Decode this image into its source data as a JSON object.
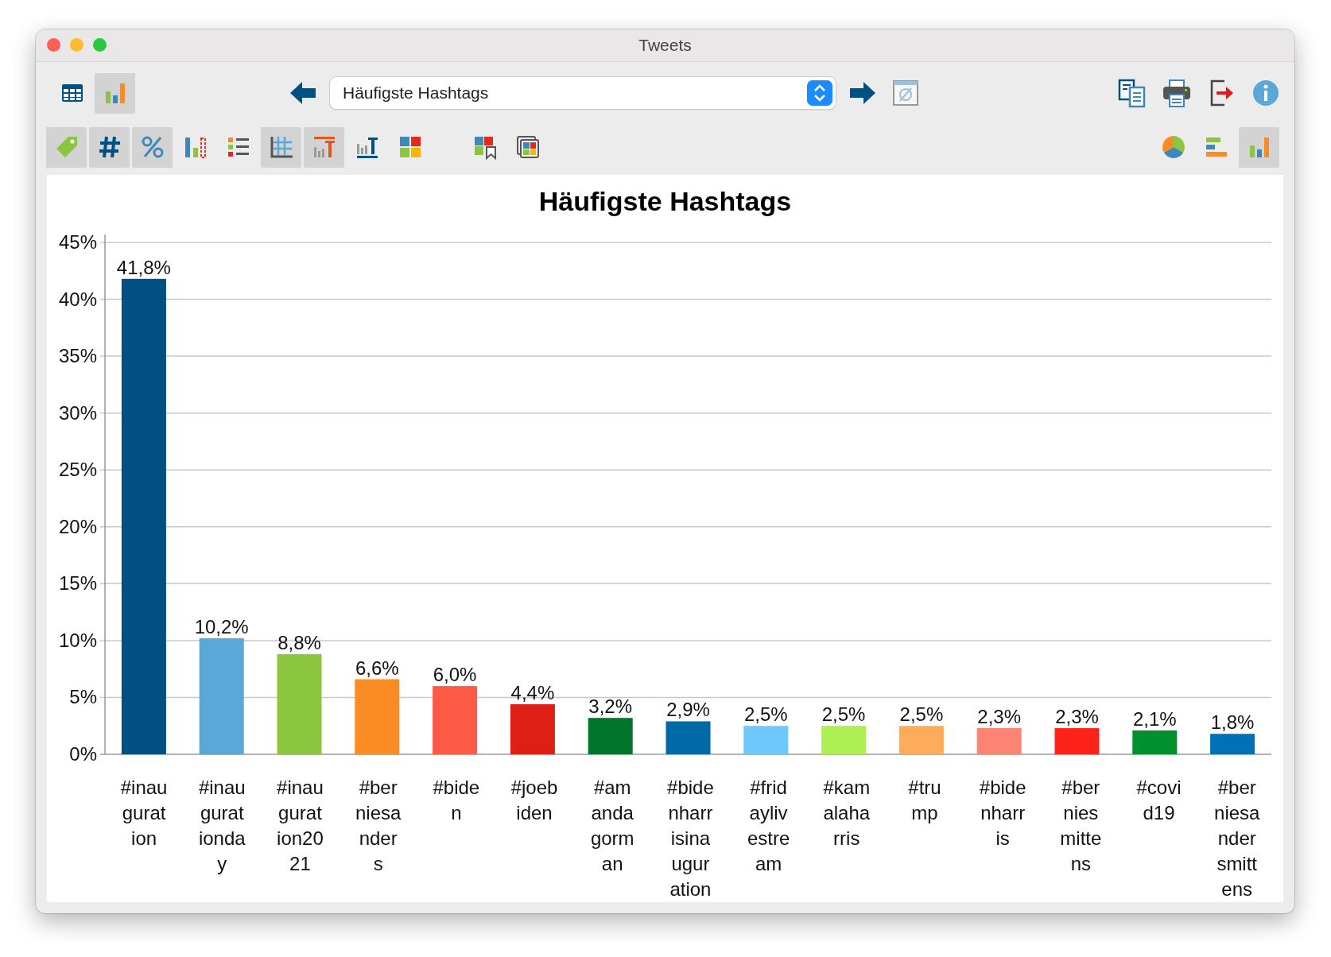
{
  "window": {
    "title": "Tweets"
  },
  "toolbar": {
    "view_buttons": [
      {
        "selected": false
      },
      {
        "selected": true
      }
    ],
    "selector": {
      "value": "Häufigste Hashtags"
    },
    "format_buttons": [
      {
        "selected": true
      },
      {
        "selected": true
      },
      {
        "selected": true
      },
      {
        "selected": false
      },
      {
        "selected": false
      },
      {
        "selected": true
      },
      {
        "selected": true
      },
      {
        "selected": false
      },
      {
        "selected": false
      },
      {
        "selected": false
      },
      {
        "selected": false
      }
    ],
    "chart_type_buttons": [
      {
        "selected": false
      },
      {
        "selected": false
      },
      {
        "selected": true
      }
    ]
  },
  "chart": {
    "chart_data": {
      "type": "bar",
      "title": "Häufigste Hashtags",
      "series": [
        {
          "name": "#inauguration",
          "color": "#005083",
          "values": [
            41.8,
            null,
            null,
            null,
            null,
            null,
            null,
            null,
            null,
            null,
            null,
            null,
            null,
            null,
            null
          ]
        },
        {
          "name": "#inaugurationday",
          "color": "#5aa8d8",
          "values": [
            null,
            10.2,
            null,
            null,
            null,
            null,
            null,
            null,
            null,
            null,
            null,
            null,
            null,
            null,
            null
          ]
        },
        {
          "name": "#inauguration2021",
          "color": "#8cc63f",
          "values": [
            null,
            null,
            8.8,
            null,
            null,
            null,
            null,
            null,
            null,
            null,
            null,
            null,
            null,
            null,
            null
          ]
        },
        {
          "name": "#berniesanders",
          "color": "#fb8c23",
          "values": [
            null,
            null,
            null,
            6.6,
            null,
            null,
            null,
            null,
            null,
            null,
            null,
            null,
            null,
            null,
            null
          ]
        },
        {
          "name": "#biden",
          "color": "#fd5a47",
          "values": [
            null,
            null,
            null,
            null,
            6.0,
            null,
            null,
            null,
            null,
            null,
            null,
            null,
            null,
            null,
            null
          ]
        },
        {
          "name": "#joebiden",
          "color": "#de1f16",
          "values": [
            null,
            null,
            null,
            null,
            null,
            4.4,
            null,
            null,
            null,
            null,
            null,
            null,
            null,
            null,
            null
          ]
        },
        {
          "name": "#amandagorman",
          "color": "#00752c",
          "values": [
            null,
            null,
            null,
            null,
            null,
            null,
            3.2,
            null,
            null,
            null,
            null,
            null,
            null,
            null,
            null
          ]
        },
        {
          "name": "#bidenharrisinauguration",
          "color": "#006aa6",
          "values": [
            null,
            null,
            null,
            null,
            null,
            null,
            null,
            2.9,
            null,
            null,
            null,
            null,
            null,
            null,
            null
          ]
        },
        {
          "name": "#fridaylivestream",
          "color": "#6ec8fb",
          "values": [
            null,
            null,
            null,
            null,
            null,
            null,
            null,
            null,
            2.5,
            null,
            null,
            null,
            null,
            null,
            null
          ]
        },
        {
          "name": "#kamalaharris",
          "color": "#acf051",
          "values": [
            null,
            null,
            null,
            null,
            null,
            null,
            null,
            null,
            null,
            2.5,
            null,
            null,
            null,
            null,
            null
          ]
        },
        {
          "name": "#trump",
          "color": "#feac5a",
          "values": [
            null,
            null,
            null,
            null,
            null,
            null,
            null,
            null,
            null,
            null,
            2.5,
            null,
            null,
            null,
            null
          ]
        },
        {
          "name": "#bidenharris",
          "color": "#fd8373",
          "values": [
            null,
            null,
            null,
            null,
            null,
            null,
            null,
            null,
            null,
            null,
            null,
            2.3,
            null,
            null,
            null
          ]
        },
        {
          "name": "#berniesmittens",
          "color": "#fe2319",
          "values": [
            null,
            null,
            null,
            null,
            null,
            null,
            null,
            null,
            null,
            null,
            null,
            null,
            2.3,
            null,
            null
          ]
        },
        {
          "name": "#covid19",
          "color": "#00912e",
          "values": [
            null,
            null,
            null,
            null,
            null,
            null,
            null,
            null,
            null,
            null,
            null,
            null,
            null,
            2.1,
            null
          ]
        },
        {
          "name": "#berniesandersmittens",
          "color": "#0071b9",
          "values": [
            null,
            null,
            null,
            null,
            null,
            null,
            null,
            null,
            null,
            null,
            null,
            null,
            null,
            null,
            1.8
          ]
        }
      ],
      "stacked": true,
      "grid": true,
      "value_labels": [
        "41,8%",
        "10,2%",
        "8,8%",
        "6,6%",
        "6,0%",
        "4,4%",
        "3,2%",
        "2,9%",
        "2,5%",
        "2,5%",
        "2,5%",
        "2,3%",
        "2,3%",
        "2,1%",
        "1,8%"
      ],
      "ylim": [
        0,
        45
      ],
      "yticks": [
        {
          "value": 0,
          "label": "0%"
        },
        {
          "value": 5,
          "label": "5%"
        },
        {
          "value": 10,
          "label": "10%"
        },
        {
          "value": 15,
          "label": "15%"
        },
        {
          "value": 20,
          "label": "20%"
        },
        {
          "value": 25,
          "label": "25%"
        },
        {
          "value": 30,
          "label": "30%"
        },
        {
          "value": 35,
          "label": "35%"
        },
        {
          "value": 40,
          "label": "40%"
        },
        {
          "value": 45,
          "label": "45%"
        }
      ]
    }
  }
}
